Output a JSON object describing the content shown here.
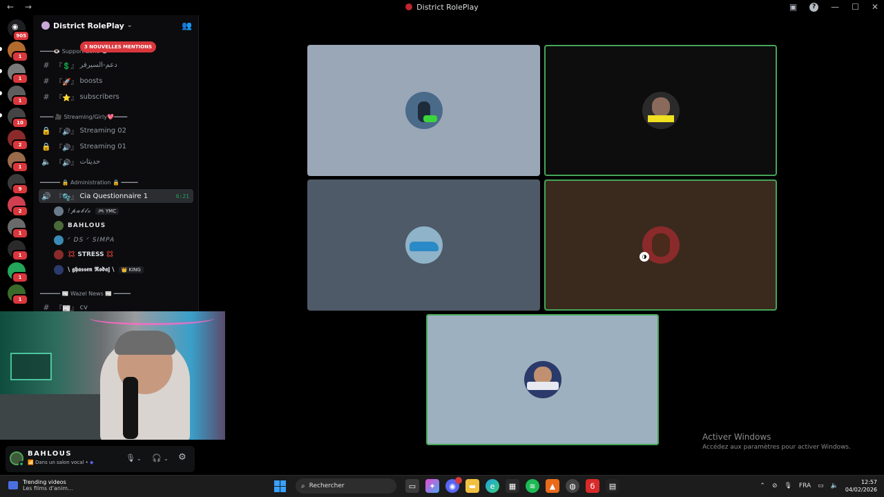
{
  "titlebar": {
    "back": "←",
    "forward": "→",
    "title": "District RolePlay",
    "minimize": "—",
    "maximize": "☐",
    "close": "✕"
  },
  "servers": [
    {
      "badge": "905",
      "color": "#1e1f22"
    },
    {
      "badge": "1",
      "color": "#b36a2e"
    },
    {
      "badge": "1",
      "color": "#7a7a7a"
    },
    {
      "badge": "1",
      "color": "#5e5e5e"
    },
    {
      "badge": "10",
      "color": "#444444"
    },
    {
      "badge": "2",
      "color": "#8b2a2a"
    },
    {
      "badge": "1",
      "color": "#9a6b4a"
    },
    {
      "badge": "9",
      "color": "#3a3a3a"
    },
    {
      "badge": "2",
      "color": "#d04050"
    },
    {
      "badge": "1",
      "color": "#6a6a6a"
    },
    {
      "badge": "1",
      "color": "#2a2a2a"
    },
    {
      "badge": "1",
      "color": "#23a55a"
    },
    {
      "badge": "1",
      "color": "#3a6a2a"
    },
    {
      "badge": "",
      "color": "#8a8a8a"
    }
  ],
  "sidebar": {
    "server_name": "District RolePlay",
    "mentions": "3 NOUVELLES MENTIONS",
    "categories": {
      "support": "━━━━👁️ Support Zone 👁️",
      "streaming": "━━━━ 🎥 Streaming/Girly💖━━━━",
      "administration": "━━━━━━ 🔒 Administration 🔒 ━━━━━",
      "wazel": "━━━━━━ 📰 Wazel News 📰 ━━━━━"
    },
    "channels": {
      "support_ar": "دعم-السيرفر",
      "boosts": "boosts",
      "subscribers": "subscribers",
      "streaming02": "Streaming 02",
      "streaming01": "Streaming 01",
      "haditat": "حديثات",
      "cia": "Cia Questionnaire 1",
      "cia_timer": "6:21",
      "cv": "cv"
    },
    "voice_users": [
      {
        "name": "!𝓹𝓪𝓫𝓵𝓸",
        "tag": "🎮 YMC"
      },
      {
        "name": "BAHLOUS",
        "tag": ""
      },
      {
        "name": "ᐟ DS ᐟ SIMPA",
        "tag": ""
      },
      {
        "name": "💢 STRESS 💢",
        "tag": ""
      },
      {
        "name": "\\ 𝖌𝖍𝖆𝖘𝖘𝖊𝖓 𝕽𝖔𝖉𝖆𝖏 \\",
        "tag": "👑 KING"
      }
    ]
  },
  "userpanel": {
    "name": "BAHLOUS",
    "status": "Dans un salon vocal •",
    "mic": "🎙",
    "headset": "🎧",
    "settings": "⚙"
  },
  "stage": {
    "tiles": [
      {
        "bg": "#9aa7b7",
        "speaking": false,
        "avatar": "#4a6a8a"
      },
      {
        "bg": "#0d0d0d",
        "speaking": true,
        "avatar": "#2a2a2a"
      },
      {
        "bg": "#4e5a68",
        "speaking": false,
        "avatar": "#3a8ab5"
      },
      {
        "bg": "#3a2a1e",
        "speaking": true,
        "avatar": "#8a2a2a"
      },
      {
        "bg": "#9db0bf",
        "speaking": true,
        "avatar": "#2a3a6a"
      }
    ]
  },
  "watermark": {
    "line1": "Activer Windows",
    "line2": "Accédez aux paramètres pour activer Windows."
  },
  "taskbar": {
    "widget_title": "Trending videos",
    "widget_sub": "Les films d'anim...",
    "search": "Rechercher",
    "lang": "FRA",
    "time": "12:57",
    "date": "04/02/2026"
  }
}
